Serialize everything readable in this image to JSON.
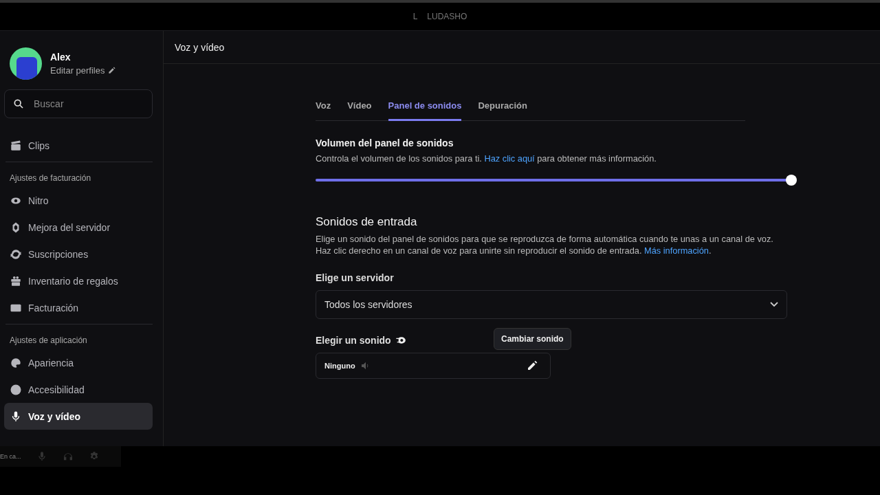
{
  "top_bar": {
    "badge": "L",
    "title": "LUDASHO"
  },
  "profile": {
    "name": "Alex",
    "edit_label": "Editar perfiles"
  },
  "search": {
    "placeholder": "Buscar"
  },
  "sidebar": {
    "groups": [
      {
        "items": [
          {
            "label": "Clips",
            "selected": false
          }
        ]
      },
      {
        "heading": "Ajustes de facturación",
        "items": [
          {
            "label": "Nitro",
            "selected": false
          },
          {
            "label": "Mejora del servidor",
            "selected": false
          },
          {
            "label": "Suscripciones",
            "selected": false
          },
          {
            "label": "Inventario de regalos",
            "selected": false
          },
          {
            "label": "Facturación",
            "selected": false
          }
        ]
      },
      {
        "heading": "Ajustes de aplicación",
        "items": [
          {
            "label": "Apariencia",
            "selected": false
          },
          {
            "label": "Accesibilidad",
            "selected": false
          },
          {
            "label": "Voz y vídeo",
            "selected": true
          }
        ]
      }
    ]
  },
  "user_panel": {
    "status": "En ca..."
  },
  "page_title": "Voz y vídeo",
  "tabs": [
    {
      "label": "Voz",
      "selected": false
    },
    {
      "label": "Vídeo",
      "selected": false
    },
    {
      "label": "Panel de sonidos",
      "selected": true
    },
    {
      "label": "Depuración",
      "selected": false
    }
  ],
  "volume": {
    "title": "Volumen del panel de sonidos",
    "description": "Controla el volumen de los sonidos para ti.",
    "link": "Haz clic aquí",
    "description_end": "para obtener más información.",
    "level": 1
  },
  "entry_sounds": {
    "title": "Sonidos de entrada",
    "description": "Elige un sonido del panel de sonidos para que se reproduzca de forma automática cuando te unas a un canal de voz. Haz clic derecho en un canal de voz para unirte sin reproducir el sonido de entrada.",
    "link": "Más información",
    "link_end": "."
  },
  "server_select": {
    "label": "Elige un servidor",
    "value": "Todos los servidores"
  },
  "sound_picker": {
    "label": "Elegir un sonido",
    "value": "Ninguno",
    "tooltip": "Cambiar sonido"
  }
}
